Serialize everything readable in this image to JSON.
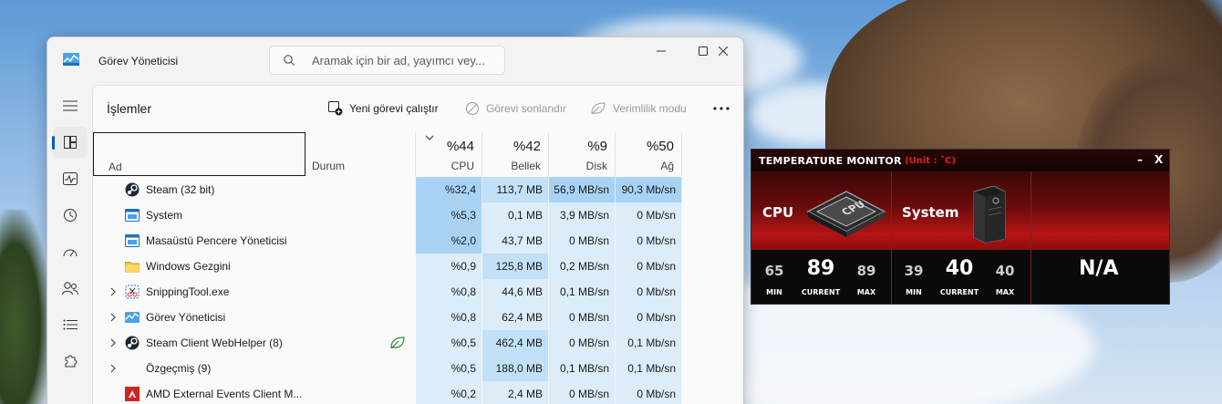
{
  "task_manager": {
    "title": "Görev Yöneticisi",
    "search_placeholder": "Aramak için bir ad, yayımcı vey...",
    "page_title": "İşlemler",
    "toolbar": {
      "run_new_task": "Yeni görevi çalıştır",
      "end_task": "Görevi sonlandır",
      "efficiency_mode": "Verimlilik modu"
    },
    "columns": {
      "name": "Ad",
      "status": "Durum",
      "cpu": {
        "pct": "%44",
        "label": "CPU"
      },
      "memory": {
        "pct": "%42",
        "label": "Bellek"
      },
      "disk": {
        "pct": "%9",
        "label": "Disk"
      },
      "network": {
        "pct": "%50",
        "label": "Ağ"
      }
    },
    "rows": [
      {
        "name": "Steam (32 bit)",
        "icon": "steam-icon",
        "expandable": false,
        "eco": false,
        "cpu": "%32,4",
        "memory": "113,7 MB",
        "disk": "56,9 MB/sn",
        "network": "90,3 Mb/sn"
      },
      {
        "name": "System",
        "icon": "system-icon",
        "expandable": false,
        "eco": false,
        "cpu": "%5,3",
        "memory": "0,1 MB",
        "disk": "3,9 MB/sn",
        "network": "0 Mb/sn"
      },
      {
        "name": "Masaüstü Pencere Yöneticisi",
        "icon": "system-icon",
        "expandable": false,
        "eco": false,
        "cpu": "%2,0",
        "memory": "43,7 MB",
        "disk": "0 MB/sn",
        "network": "0 Mb/sn"
      },
      {
        "name": "Windows Gezgini",
        "icon": "folder-icon",
        "expandable": false,
        "eco": false,
        "cpu": "%0,9",
        "memory": "125,8 MB",
        "disk": "0,2 MB/sn",
        "network": "0 Mb/sn"
      },
      {
        "name": "SnippingTool.exe",
        "icon": "snipping-tool-icon",
        "expandable": true,
        "eco": false,
        "cpu": "%0,8",
        "memory": "44,6 MB",
        "disk": "0,1 MB/sn",
        "network": "0 Mb/sn"
      },
      {
        "name": "Görev Yöneticisi",
        "icon": "task-manager-icon",
        "expandable": true,
        "eco": false,
        "cpu": "%0,8",
        "memory": "62,4 MB",
        "disk": "0 MB/sn",
        "network": "0 Mb/sn"
      },
      {
        "name": "Steam Client WebHelper (8)",
        "icon": "steam-icon",
        "expandable": true,
        "eco": true,
        "cpu": "%0,5",
        "memory": "462,4 MB",
        "disk": "0 MB/sn",
        "network": "0,1 Mb/sn"
      },
      {
        "name": "Özgeçmiş (9)",
        "icon": "none",
        "expandable": true,
        "eco": false,
        "cpu": "%0,5",
        "memory": "188,0 MB",
        "disk": "0,1 MB/sn",
        "network": "0,1 Mb/sn"
      },
      {
        "name": "AMD External Events Client M...",
        "icon": "amd-icon",
        "expandable": false,
        "eco": false,
        "cpu": "%0,2",
        "memory": "2,4 MB",
        "disk": "0 MB/sn",
        "network": "0 Mb/sn"
      }
    ],
    "heat_colors": {
      "light": "#dcecf9",
      "medium": "#c2e0f7",
      "strong": "#a9d3f5"
    }
  },
  "temperature_monitor": {
    "title": "TEMPERATURE MONITOR",
    "unit": "(Unit : ˚C)",
    "minimize": "–",
    "close": "X",
    "cpu": {
      "label": "CPU",
      "min": "65",
      "current": "89",
      "max": "89"
    },
    "system": {
      "label": "System",
      "min": "39",
      "current": "40",
      "max": "40"
    },
    "third": "N/A",
    "stat_labels": {
      "min": "MIN",
      "current": "CURRENT",
      "max": "MAX"
    },
    "accent": "#e02020"
  }
}
